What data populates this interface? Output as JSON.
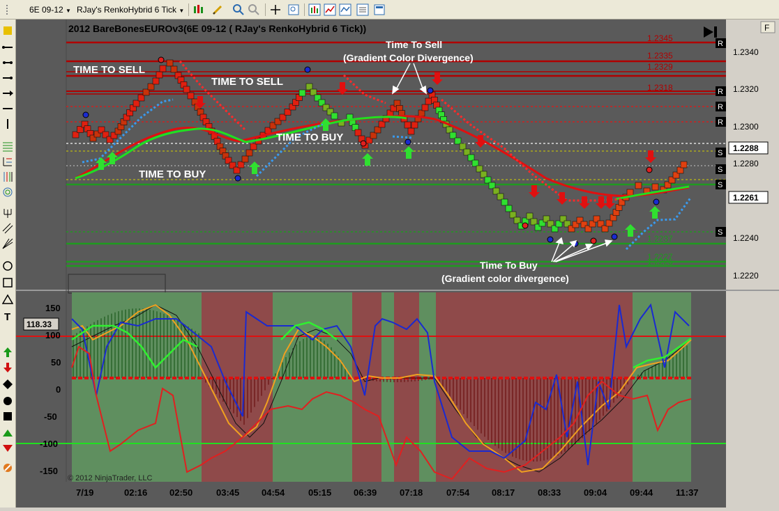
{
  "toolbar": {
    "instrument": "6E 09-12",
    "chart_type": "RJay's RenkoHybrid  6 Tick"
  },
  "chart": {
    "title": "2012 BareBonesEUROv3(6E 09-12 ( RJay's RenkoHybrid  6 Tick))",
    "f_button": "F",
    "copyright": "© 2012 NinjaTrader, LLC",
    "price_axis": [
      "1.2340",
      "1.2320",
      "1.2300",
      "1.2280",
      "1.2240",
      "1.2220"
    ],
    "price_current": "1.2288",
    "price_marker2": "1.2261",
    "levels": [
      {
        "label": "1.2345",
        "color": "#b00000"
      },
      {
        "label": "1.2335",
        "color": "#b00000"
      },
      {
        "label": "1.2329",
        "color": "#b00000"
      },
      {
        "label": "1.2318",
        "color": "#b00000"
      },
      {
        "label": "1.2237",
        "color": "#1f9a1f"
      },
      {
        "label": "1.2227",
        "color": "#1f9a1f"
      },
      {
        "label": "1.2226",
        "color": "#1f9a1f"
      }
    ],
    "side_tags": [
      "R",
      "R",
      "R",
      "R",
      "S",
      "S",
      "S",
      "S"
    ],
    "annotations": {
      "sell1": "TIME TO SELL",
      "sell2": "TIME TO SELL",
      "buy1": "TIME TO BUY",
      "buy2": "TIME TO BUY",
      "sell_div_1": "Time To Sell",
      "sell_div_2": "(Gradient Color Divergence)",
      "buy_div_1": "Time To Buy",
      "buy_div_2": "(Gradient color divergence)"
    },
    "osc_axis": [
      "150",
      "100",
      "50",
      "0",
      "-50",
      "-100",
      "-150"
    ],
    "osc_marker": "118.33",
    "time_axis": [
      "7/19",
      "02:16",
      "02:50",
      "03:45",
      "04:54",
      "05:15",
      "06:39",
      "07:18",
      "07:54",
      "08:17",
      "08:33",
      "09:04",
      "09:44",
      "11:37"
    ],
    "colors": {
      "background": "#5a5a5a",
      "resistance": "#b00000",
      "support": "#1f9a1f",
      "zone_green": "#5f8f5f",
      "zone_red": "#8f4a4a"
    }
  }
}
